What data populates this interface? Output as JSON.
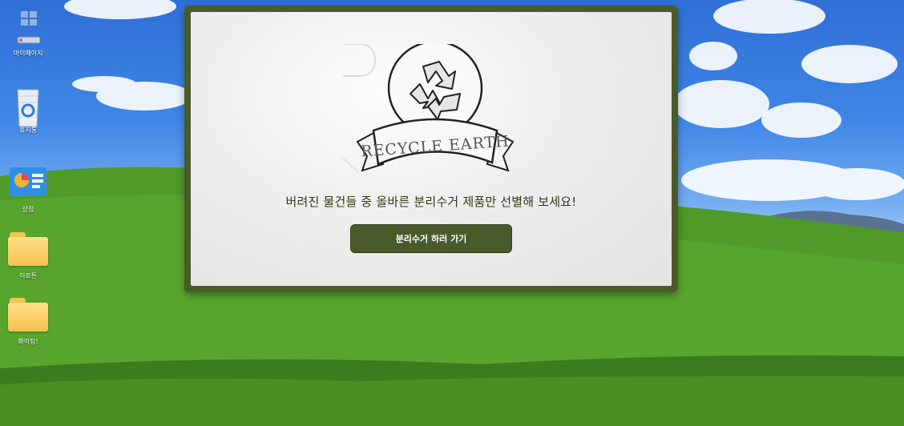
{
  "desktop": {
    "icons": [
      {
        "label": "마이페이지",
        "icon": "window-cards-icon"
      },
      {
        "label": "휴지통",
        "icon": "recycle-bin-icon"
      },
      {
        "label": "상점",
        "icon": "shop-chart-icon"
      },
      {
        "label": "이로튼",
        "icon": "folder-icon"
      },
      {
        "label": "화이팅!",
        "icon": "folder-icon"
      }
    ]
  },
  "dialog": {
    "logo_text": "RECYCLE EARTH",
    "headline": "버려진 물건들 중 올바른 분리수거 제품만 선별해 보세요!",
    "cta_label": "분리수거 하러 가기"
  },
  "colors": {
    "dialog_frame": "#4a5a2b",
    "sky": "#3f86e6",
    "grass": "#5aa02c"
  }
}
